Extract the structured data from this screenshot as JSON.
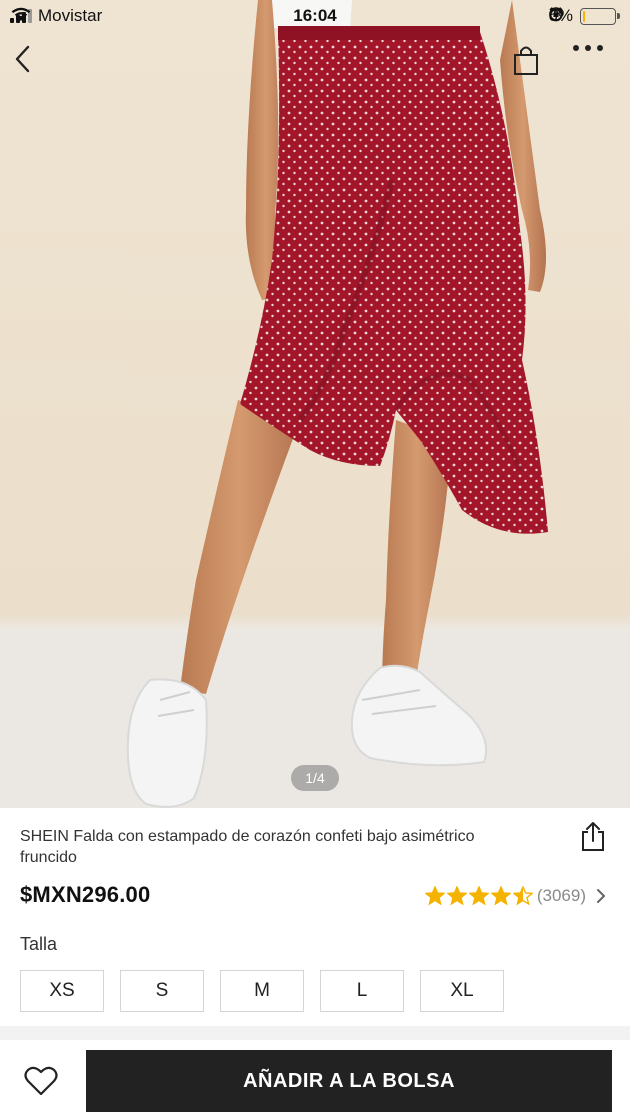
{
  "status_bar": {
    "carrier": "Movistar",
    "time": "16:04",
    "battery_percent": "6%",
    "battery_level": 0.06,
    "signal_bars_filled": 3,
    "signal_bars_total": 4
  },
  "nav": {
    "back_icon": "chevron-left-icon",
    "bag_icon": "shopping-bag-icon",
    "more_icon": "more-dots-icon"
  },
  "gallery": {
    "page_indicator": "1/4"
  },
  "product": {
    "title": "SHEIN Falda con estampado de corazón confeti bajo asimétrico fruncido",
    "price": "$MXN296.00",
    "rating_value": 4.5,
    "review_count": "(3069)"
  },
  "size": {
    "label": "Talla",
    "options": [
      "XS",
      "S",
      "M",
      "L",
      "XL"
    ]
  },
  "actions": {
    "add_to_bag": "AÑADIR A LA BOLSA"
  },
  "colors": {
    "skirt": "#a3162a",
    "star": "#f5b301",
    "button_bg": "#222222"
  }
}
